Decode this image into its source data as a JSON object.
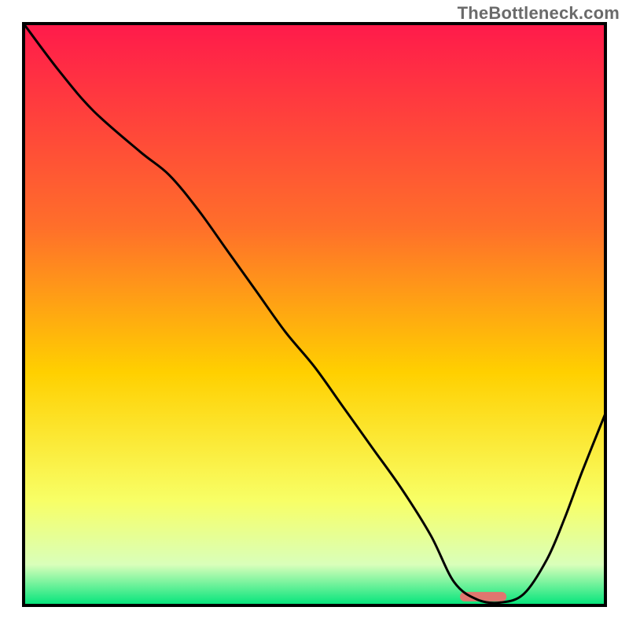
{
  "watermark": "TheBottleneck.com",
  "chart_data": {
    "type": "line",
    "title": "",
    "xlabel": "",
    "ylabel": "",
    "xlim": [
      0,
      100
    ],
    "ylim": [
      0,
      100
    ],
    "x": [
      0,
      6,
      12,
      20,
      25,
      30,
      35,
      40,
      45,
      50,
      55,
      60,
      65,
      70,
      74,
      78,
      82,
      86,
      90,
      93,
      96,
      100
    ],
    "values": [
      100,
      92,
      85,
      78,
      74,
      68,
      61,
      54,
      47,
      41,
      34,
      27,
      20,
      12,
      4,
      1,
      0.5,
      2,
      8,
      15,
      23,
      33
    ],
    "marker": {
      "x_start": 75,
      "x_end": 83,
      "y": 1.5
    },
    "grid": false,
    "legend": false
  },
  "colors": {
    "gradient_top": "#ff1a4b",
    "gradient_mid1": "#ff6f2a",
    "gradient_mid2": "#ffd000",
    "gradient_mid3": "#f8ff66",
    "gradient_mid4": "#d9ffba",
    "gradient_bottom": "#00e47a",
    "line": "#000000",
    "marker": "#e0766f",
    "frame": "#000000"
  }
}
